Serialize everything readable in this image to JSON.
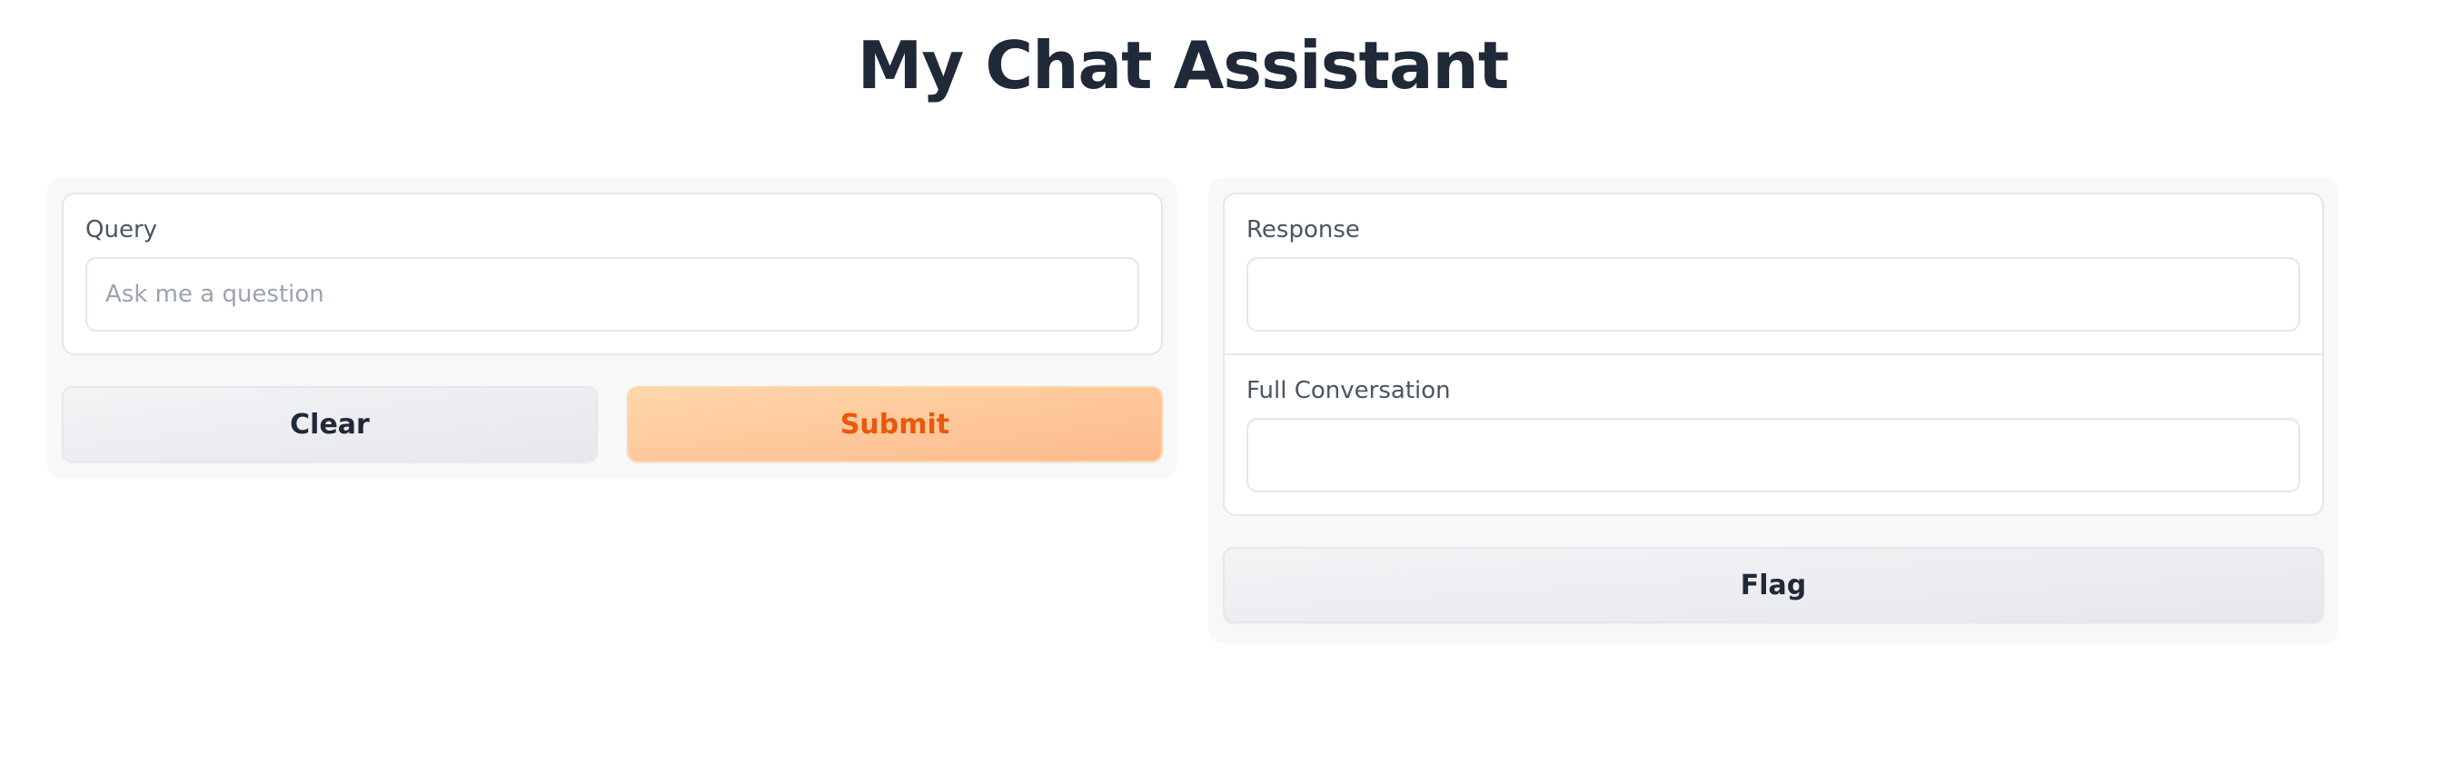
{
  "app": {
    "title": "My Chat Assistant"
  },
  "input_panel": {
    "query": {
      "label": "Query",
      "value": "",
      "placeholder": "Ask me a question"
    },
    "clear_label": "Clear",
    "submit_label": "Submit"
  },
  "output_panel": {
    "response": {
      "label": "Response",
      "value": ""
    },
    "conversation": {
      "label": "Full Conversation",
      "value": ""
    },
    "flag_label": "Flag"
  },
  "colors": {
    "primary_text": "#ea580c",
    "primary_bg": "#fdba8c",
    "heading": "#1f2937"
  }
}
